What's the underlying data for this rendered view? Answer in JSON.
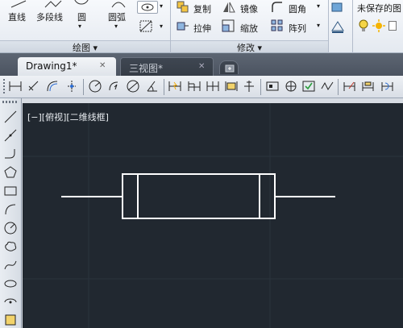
{
  "ribbon": {
    "draw": {
      "line": "直线",
      "polyline": "多段线",
      "circle": "圆",
      "arc": "圆弧",
      "panel_title": "绘图 ▾"
    },
    "modify": {
      "copy": "复制",
      "mirror": "镜像",
      "fillet": "圆角",
      "stretch": "拉伸",
      "scale": "缩放",
      "array": "阵列",
      "panel_title": "修改 ▾"
    },
    "layers": {
      "state": "未保存的图"
    }
  },
  "tabs": [
    {
      "label": "Drawing1*",
      "close": "✕",
      "active": true
    },
    {
      "label": "三视图*",
      "close": "✕",
      "active": false
    }
  ],
  "viewport": {
    "label": "[−][俯视][二维线框]"
  },
  "colors": {
    "canvas_bg": "#212830",
    "drawing_stroke": "#ffffff",
    "tab_strip": "#4f5764"
  }
}
